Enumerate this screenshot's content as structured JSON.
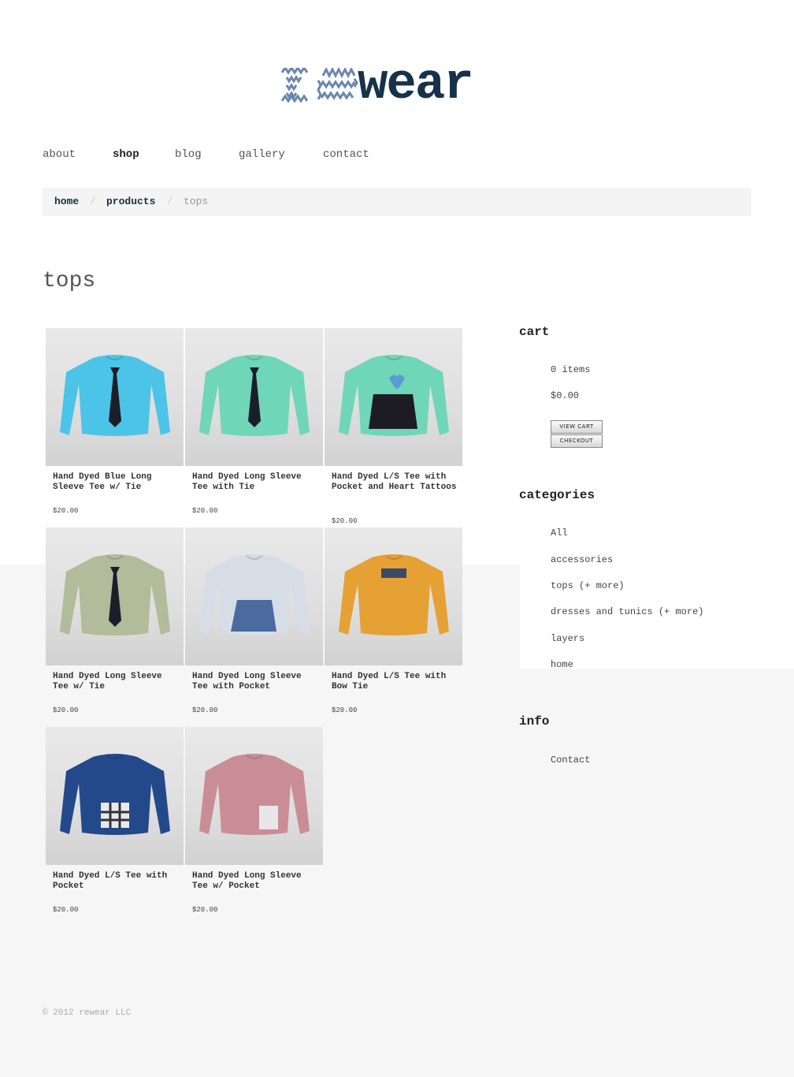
{
  "brand": {
    "logo_text": "wear",
    "logo_full": "rewear"
  },
  "nav": {
    "items": [
      "about",
      "shop",
      "blog",
      "gallery",
      "contact"
    ],
    "active": "shop"
  },
  "breadcrumb": {
    "home": "home",
    "products": "products",
    "current": "tops",
    "sep": "/"
  },
  "page": {
    "title": "tops"
  },
  "products": [
    {
      "name": "Hand Dyed Blue Long Sleeve Tee w/ Tie",
      "price": "$20.00",
      "color": "#4cc4e8",
      "detail": "tie"
    },
    {
      "name": "Hand Dyed Long Sleeve Tee with Tie",
      "price": "$20.00",
      "color": "#6fd6b8",
      "detail": "tie"
    },
    {
      "name": "Hand Dyed L/S Tee with Pocket and Heart Tattoos",
      "price": "$20.00",
      "color": "#6fd6b8",
      "detail": "pocket-heart"
    },
    {
      "name": "Hand Dyed Long Sleeve Tee w/ Tie",
      "price": "$20.00",
      "color": "#b2bb9a",
      "detail": "tie"
    },
    {
      "name": "Hand Dyed Long Sleeve Tee with Pocket",
      "price": "$20.00",
      "color": "#d6dde6",
      "detail": "pocket-blue"
    },
    {
      "name": "Hand Dyed L/S Tee with Bow Tie",
      "price": "$20.00",
      "color": "#e6a135",
      "detail": "bowtie"
    },
    {
      "name": "Hand Dyed L/S Tee with Pocket",
      "price": "$20.00",
      "color": "#23498a",
      "detail": "pocket-plaid"
    },
    {
      "name": "Hand Dyed Long Sleeve Tee w/ Pocket",
      "price": "$20.00",
      "color": "#c98d96",
      "detail": "pocket-light"
    }
  ],
  "sidebar": {
    "cart": {
      "title": "cart",
      "items": "0 items",
      "total": "$0.00",
      "view_cart": "VIEW CART",
      "checkout": "CHECKOUT"
    },
    "categories": {
      "title": "categories",
      "items": [
        "All",
        "accessories",
        "tops (+ more)",
        "dresses and tunics (+ more)",
        "layers",
        "home"
      ]
    },
    "info": {
      "title": "info",
      "items": [
        "Contact"
      ]
    }
  },
  "footer": {
    "text": "© 2012 rewear LLC"
  },
  "colors": {
    "brand": "#15324a",
    "logo_zigzag": "#6b86b0"
  }
}
